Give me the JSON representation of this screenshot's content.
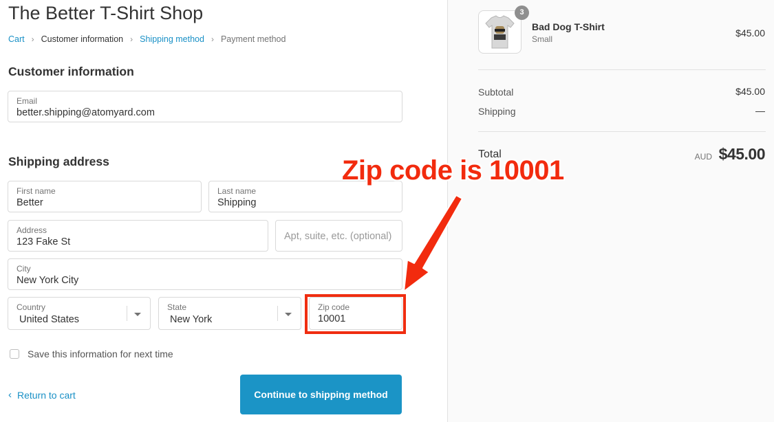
{
  "shop": {
    "title": "The Better T-Shirt Shop"
  },
  "breadcrumb": [
    {
      "label": "Cart"
    },
    {
      "label": "Customer information"
    },
    {
      "label": "Shipping method"
    },
    {
      "label": "Payment method"
    }
  ],
  "customer": {
    "section_title": "Customer information",
    "email": {
      "label": "Email",
      "value": "better.shipping@atomyard.com"
    }
  },
  "shipping": {
    "section_title": "Shipping address",
    "first_name": {
      "label": "First name",
      "value": "Better"
    },
    "last_name": {
      "label": "Last name",
      "value": "Shipping"
    },
    "address": {
      "label": "Address",
      "value": "123 Fake St"
    },
    "apt": {
      "placeholder": "Apt, suite, etc. (optional)"
    },
    "city": {
      "label": "City",
      "value": "New York City"
    },
    "country": {
      "label": "Country",
      "value": "United States"
    },
    "state": {
      "label": "State",
      "value": "New York"
    },
    "zip": {
      "label": "Zip code",
      "value": "10001"
    }
  },
  "save_info": {
    "label": "Save this information for next time",
    "checked": false
  },
  "actions": {
    "return_label": "Return to cart",
    "continue_label": "Continue to shipping method"
  },
  "annotation": {
    "text": "Zip code is 10001",
    "color": "#f22b0e"
  },
  "order": {
    "product": {
      "name": "Bad Dog T-Shirt",
      "variant": "Small",
      "price": "$45.00",
      "quantity": "3"
    },
    "subtotal_label": "Subtotal",
    "subtotal_value": "$45.00",
    "shipping_label": "Shipping",
    "shipping_value": "—",
    "total_label": "Total",
    "total_currency": "AUD",
    "total_value": "$45.00"
  },
  "colors": {
    "accent": "#1990c6",
    "button": "#1b94c6",
    "annotation": "#f02d10"
  }
}
